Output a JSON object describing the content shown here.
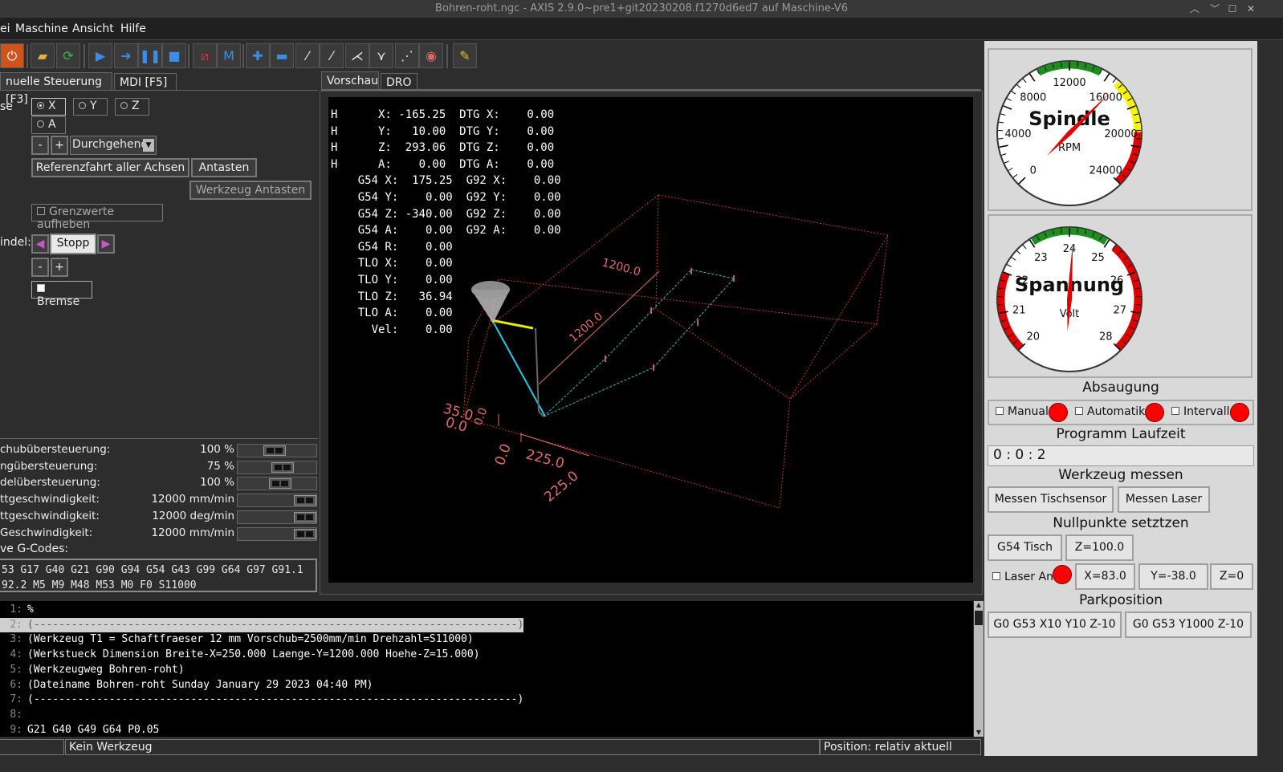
{
  "window": {
    "title": "Bohren-roht.ngc - AXIS 2.9.0~pre1+git20230208.f1270d6ed7 auf Maschine-V6"
  },
  "menu": [
    "ei",
    "Maschine",
    "Ansicht",
    "Hilfe"
  ],
  "toolbar": {
    "icons": [
      "estop-icon",
      "open-file-icon",
      "reload-icon",
      "run-icon",
      "step-icon",
      "pause-icon",
      "stop-icon",
      "block-delete-icon",
      "optional-stop-icon",
      "zoom-in-icon",
      "zoom-out-icon",
      "view-z-icon",
      "view-z2-icon",
      "view-x-icon",
      "view-y-icon",
      "view-p-icon",
      "rotate-icon",
      "clear-plot-icon"
    ]
  },
  "tabs": {
    "manual": "nuelle Steuerung [F3]",
    "mdi": "MDI [F5]",
    "preview": "Vorschau",
    "dro": "DRO"
  },
  "manual": {
    "axis_label": "se",
    "axes": [
      "X",
      "Y",
      "Z",
      "A"
    ],
    "selected_axis": "X",
    "minus": "-",
    "plus": "+",
    "jog_mode": "Durchgehend",
    "home_all": "Referenzfahrt aller Achsen",
    "touch_off": "Antasten",
    "tool_touch_off": "Werkzeug Antasten",
    "override_limits": "Grenzwerte aufheben",
    "spindle_label": "indel:",
    "spindle_stop": "Stopp",
    "brake": "Bremse"
  },
  "overrides": [
    {
      "label": "chubübersteuerung:",
      "value": "100 %",
      "frac": 0.45
    },
    {
      "label": "ngübersteuerung:",
      "value": "75 %",
      "frac": 0.6
    },
    {
      "label": "delübersteuerung:",
      "value": "100 %",
      "frac": 0.55
    },
    {
      "label": "ttgeschwindigkeit:",
      "value": "12000 mm/min",
      "frac": 1.0
    },
    {
      "label": "ttgeschwindigkeit:",
      "value": "12000 deg/min",
      "frac": 1.0
    },
    {
      "label": "Geschwindigkeit:",
      "value": "12000 mm/min",
      "frac": 1.0
    }
  ],
  "gcodes": {
    "label": "ve G-Codes:",
    "line1": "53 G17 G40 G21 G90 G94 G54 G43 G99 G64 G97 G91.1",
    "line2": "92.2 M5 M9 M48 M53 M0 F0 S11000"
  },
  "dro_text": "H      X: -165.25  DTG X:    0.00\nH      Y:   10.00  DTG Y:    0.00\nH      Z:  293.06  DTG Z:    0.00\nH      A:    0.00  DTG A:    0.00\n    G54 X:  175.25  G92 X:    0.00\n    G54 Y:    0.00  G92 Y:    0.00\n    G54 Z: -340.00  G92 Z:    0.00\n    G54 A:    0.00  G92 A:    0.00\n    G54 R:    0.00\n    TLO X:    0.00\n    TLO Y:    0.00\n    TLO Z:   36.94\n    TLO A:    0.00\n      Vel:    0.00",
  "preview_labels": {
    "dim1": "1200.0",
    "dim2": "1200.0",
    "dim3": "225.0",
    "dim4": "225.0",
    "dim5": "35.0",
    "dim6": "0.0",
    "dim7": "0.0",
    "dim8": "0.0"
  },
  "gcode_lines": [
    {
      "n": "1:",
      "t": "%"
    },
    {
      "n": "2:",
      "t": "(-----------------------------------------------------------------------------)"
    },
    {
      "n": "3:",
      "t": "(Werkzeug T1 = Schaftfraeser 12 mm Vorschub=2500mm/min Drehzahl=S11000)"
    },
    {
      "n": "4:",
      "t": "(Werkstueck Dimension Breite-X=250.000 Laenge-Y=1200.000 Hoehe-Z=15.000)"
    },
    {
      "n": "5:",
      "t": "(Werkzeugweg Bohren-roht)"
    },
    {
      "n": "6:",
      "t": "(Dateiname Bohren-roht Sunday January 29 2023 04:40 PM)"
    },
    {
      "n": "7:",
      "t": "(-----------------------------------------------------------------------------)"
    },
    {
      "n": "8:",
      "t": ""
    },
    {
      "n": "9:",
      "t": "G21 G40 G49 G64 P0.05"
    }
  ],
  "status": {
    "tool": "Kein Werkzeug",
    "position": "Position: relativ aktuell"
  },
  "spindle_gauge": {
    "title": "Spindle",
    "unit": "RPM",
    "ticks": [
      "0",
      "4000",
      "8000",
      "12000",
      "16000",
      "20000",
      "24000"
    ],
    "value": 16000,
    "min": 0,
    "max": 24000
  },
  "voltage_gauge": {
    "title": "Spannung",
    "unit": "Volt",
    "ticks": [
      "20",
      "21",
      "22",
      "23",
      "24",
      "25",
      "26",
      "27",
      "28"
    ],
    "value": 24.1,
    "min": 20,
    "max": 28
  },
  "panel": {
    "suction": "Absaugung",
    "manual": "Manual",
    "auto": "Automatik",
    "interval": "Intervall",
    "runtime_label": "Programm Laufzeit",
    "runtime": "0 : 0 : 2",
    "tool_measure": "Werkzeug messen",
    "measure_table": "Messen Tischsensor",
    "measure_laser": "Messen Laser",
    "zero_label": "Nullpunkte setztzen",
    "g54_table": "G54 Tisch",
    "z100": "Z=100.0",
    "laser_on": "Laser An",
    "x83": "X=83.0",
    "y38": "Y=-38.0",
    "z0": "Z=0",
    "park_label": "Parkposition",
    "park1": "G0 G53 X10 Y10 Z-10",
    "park2": "G0 G53 Y1000 Z-10"
  },
  "colors": {
    "led_red": "#ff0000",
    "gauge_green": "#1e8f1e",
    "gauge_yellow": "#f5f500",
    "gauge_red": "#e00000",
    "preview_red": "#c83232"
  }
}
